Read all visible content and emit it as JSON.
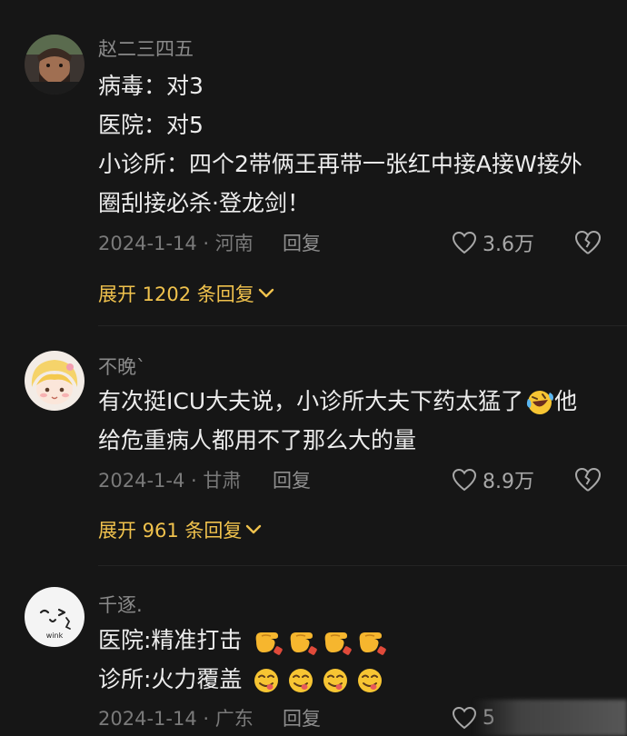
{
  "comments": [
    {
      "username": "赵二三四五",
      "lines": [
        "病毒：对3",
        "医院：对5",
        "小诊所：四个2带俩王再带一张红中接A接W接外",
        "圈刮接必杀·登龙剑！"
      ],
      "date_location": "2024-1-14 · 河南",
      "reply_label": "回复",
      "likes": "3.6万",
      "expand_label": "展开 1202 条回复"
    },
    {
      "username": "不晚`",
      "lines": [
        "有次挺ICU大夫说，小诊所大夫下药太猛了",
        "给危重病人都用不了那么大的量"
      ],
      "line1_tail": "他",
      "date_location": "2024-1-4 · 甘肃",
      "reply_label": "回复",
      "likes": "8.9万",
      "expand_label": "展开 961 条回复"
    },
    {
      "username": "千逐.",
      "lines": [
        "医院:精准打击",
        "诊所:火力覆盖"
      ],
      "date_location": "2024-1-14 · 广东",
      "reply_label": "回复",
      "likes": "5",
      "avatar_text": "wink"
    }
  ],
  "colors": {
    "background": "#161616",
    "text": "#ececec",
    "muted": "#7a7a7a",
    "expand": "#f0c24d"
  },
  "icons": [
    "heart-outline-icon",
    "broken-heart-icon",
    "chevron-down-icon",
    "laughing-tears-emoji",
    "pointing-hand-emoji",
    "yum-face-emoji"
  ]
}
